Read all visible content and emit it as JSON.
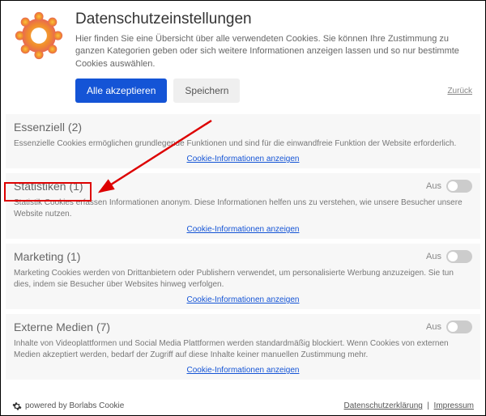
{
  "header": {
    "title": "Datenschutzeinstellungen",
    "description": "Hier finden Sie eine Übersicht über alle verwendeten Cookies. Sie können Ihre Zustimmung zu ganzen Kategorien geben oder sich weitere Informationen anzeigen lassen und so nur bestimmte Cookies auswählen."
  },
  "buttons": {
    "accept_all": "Alle akzeptieren",
    "save": "Speichern",
    "back": "Zurück"
  },
  "info_link": "Cookie-Informationen anzeigen",
  "off_label": "Aus",
  "categories": [
    {
      "title": "Essenziell (2)",
      "desc": "Essenzielle Cookies ermöglichen grundlegende Funktionen und sind für die einwandfreie Funktion der Website erforderlich.",
      "has_toggle": false
    },
    {
      "title": "Statistiken (1)",
      "desc": "Statistik Cookies erfassen Informationen anonym. Diese Informationen helfen uns zu verstehen, wie unsere Besucher unsere Website nutzen.",
      "has_toggle": true
    },
    {
      "title": "Marketing (1)",
      "desc": "Marketing Cookies werden von Drittanbietern oder Publishern verwendet, um personalisierte Werbung anzuzeigen. Sie tun dies, indem sie Besucher über Websites hinweg verfolgen.",
      "has_toggle": true
    },
    {
      "title": "Externe Medien (7)",
      "desc": "Inhalte von Videoplattformen und Social Media Plattformen werden standardmäßig blockiert. Wenn Cookies von externen Medien akzeptiert werden, bedarf der Zugriff auf diese Inhalte keiner manuellen Zustimmung mehr.",
      "has_toggle": true
    }
  ],
  "footer": {
    "powered": "powered by Borlabs Cookie",
    "privacy": "Datenschutzerklärung",
    "imprint": "Impressum"
  }
}
